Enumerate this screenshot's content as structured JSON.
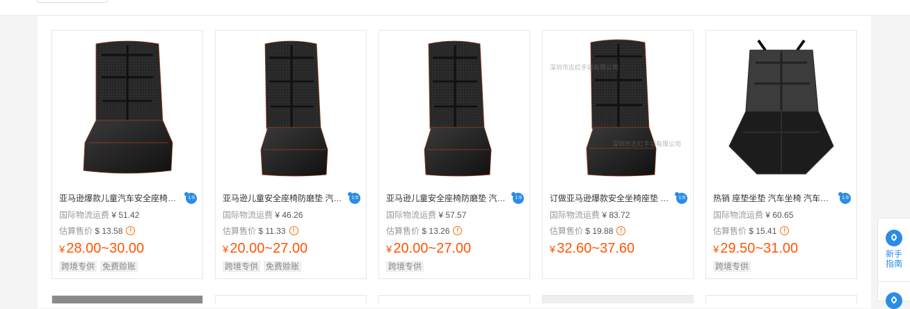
{
  "products": [
    {
      "title": "亚马逊爆款儿童汽车安全座椅防磨垫 汽车坐垫",
      "shipping_label": "国际物流运费",
      "shipping_value": "¥ 51.42",
      "est_label": "估算售价",
      "est_value": "$ 13.58",
      "currency": "¥",
      "price": "28.00~30.00",
      "tags": [
        "跨境专供",
        "免费赊账"
      ],
      "watermark": ""
    },
    {
      "title": "亚马逊儿童安全座椅防磨垫 汽车坐垫",
      "shipping_label": "国际物流运费",
      "shipping_value": "¥ 46.26",
      "est_label": "估算售价",
      "est_value": "$ 11.33",
      "currency": "¥",
      "price": "20.00~27.00",
      "tags": [
        "跨境专供",
        "免费赊账"
      ],
      "watermark": ""
    },
    {
      "title": "亚马逊儿童安全座椅防磨垫 汽车坐垫",
      "shipping_label": "国际物流运费",
      "shipping_value": "¥ 57.57",
      "est_label": "估算售价",
      "est_value": "$ 13.26",
      "currency": "¥",
      "price": "20.00~27.00",
      "tags": [
        "跨境专供"
      ],
      "watermark": ""
    },
    {
      "title": "订做亚马逊爆款安全坐椅座垫 汽车坐垫",
      "shipping_label": "国际物流运费",
      "shipping_value": "¥ 83.72",
      "est_label": "估算售价",
      "est_value": "$ 19.88",
      "currency": "¥",
      "price": "32.60~37.60",
      "tags": [],
      "watermark": "深圳市志红手袋有限公司"
    },
    {
      "title": "热销 座垫坐垫 汽车坐椅 汽车座垫",
      "shipping_label": "国际物流运费",
      "shipping_value": "¥ 60.65",
      "est_label": "估算售价",
      "est_value": "$ 15.41",
      "currency": "¥",
      "price": "29.50~31.00",
      "tags": [
        "跨境专供"
      ],
      "watermark": ""
    }
  ],
  "side_panel": {
    "guide_label_1": "新手",
    "guide_label_2": "指南"
  },
  "icons": {
    "wangwang": "wangwang-chat-icon",
    "info": "info-warning-icon",
    "compass": "compass-icon"
  },
  "colors": {
    "price": "#ff5500",
    "accent": "#2a8ce8",
    "warning": "#ff6a00"
  }
}
